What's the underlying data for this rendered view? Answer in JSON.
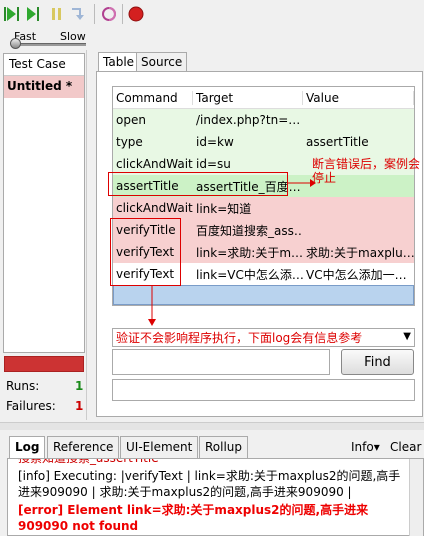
{
  "toolbar": {
    "speed_fast": "Fast",
    "speed_slow": "Slow"
  },
  "test_case_panel": {
    "header": "Test Case",
    "item": "Untitled *",
    "runs_label": "Runs:",
    "runs_value": "1",
    "failures_label": "Failures:",
    "failures_value": "1"
  },
  "tabs": {
    "table": "Table",
    "source": "Source"
  },
  "table": {
    "headers": [
      "Command",
      "Target",
      "Value"
    ],
    "rows": [
      {
        "command": "open",
        "target": "/index.php?tn=…",
        "value": ""
      },
      {
        "command": "type",
        "target": "id=kw",
        "value": "assertTitle"
      },
      {
        "command": "clickAndWait",
        "target": "id=su",
        "value": ""
      },
      {
        "command": "assertTitle",
        "target": "assertTitle_百度…",
        "value": ""
      },
      {
        "command": "clickAndWait",
        "target": "link=知道",
        "value": ""
      },
      {
        "command": "verifyTitle",
        "target": "百度知道搜索_ass…",
        "value": ""
      },
      {
        "command": "verifyText",
        "target": "link=求助:关于m…",
        "value": "求助:关于maxplu…"
      },
      {
        "command": "verifyText",
        "target": "link=VC中怎么添…",
        "value": "VC中怎么添加一…"
      }
    ]
  },
  "annotations": {
    "assert_note_line1": "断言错误后，案例会",
    "assert_note_line2": "停止",
    "verify_note": "验证不会影响程序执行，下面log会有信息参考"
  },
  "find_button": "Find",
  "log": {
    "tabs": [
      "Log",
      "Reference",
      "UI-Element",
      "Rollup"
    ],
    "info_menu": "Info▾",
    "clear": "Clear",
    "cut_line": "搜索知道搜索_assertTitle",
    "info_line": "[info] Executing: |verifyText | link=求助:关于maxplus2的问题,高手进来909090 | 求助:关于maxplus2的问题,高手进来909090 |",
    "error_line": "[error] Element link=求助:关于maxplus2的问题,高手进来909090 not found"
  },
  "colors": {
    "pass_green": "#e8f8e4",
    "fail_red": "#f7d0d0",
    "annotation_red": "#dd0000"
  }
}
